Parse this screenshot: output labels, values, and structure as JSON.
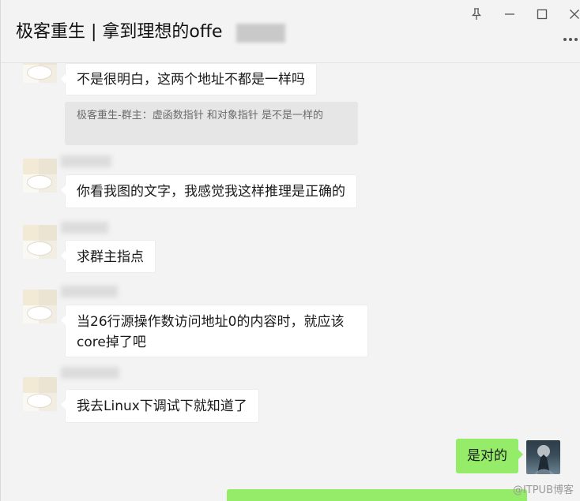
{
  "window": {
    "title": "极客重生 | 拿到理想的offe"
  },
  "messages": [
    {
      "text": "不是很明白，这两个地址不都是一样吗"
    },
    {
      "text": "极客重生-群主：虚函数指针 和对象指针 是不是一样的",
      "type": "quote"
    },
    {
      "text": "你看我图的文字，我感觉我这样推理是正确的"
    },
    {
      "text": "求群主指点"
    },
    {
      "text": "当26行源操作数访问地址0的内容时，就应该core掉了吧"
    },
    {
      "text": "我去Linux下调试下就知道了"
    },
    {
      "text": "是对的",
      "side": "me"
    }
  ],
  "watermark": "@ITPUB博客",
  "colors": {
    "window_bg": "#f3f3f3",
    "bubble_other": "#ffffff",
    "bubble_me": "#95ec69",
    "quote_bg": "#e6e6e6"
  },
  "icons": [
    "pin-icon",
    "minimize-icon",
    "maximize-icon",
    "close-icon",
    "more-icon"
  ]
}
